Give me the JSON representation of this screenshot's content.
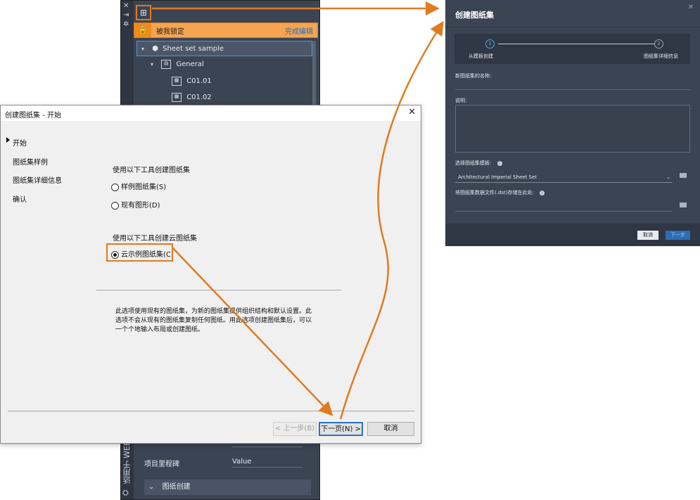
{
  "palette": {
    "rail_icons": [
      "close-icon",
      "pin-icon",
      "settings-icon"
    ],
    "rail_vertical_text": "适用于 WEB 的",
    "new_sheet_set_glyph": "⊞",
    "lock_bar": {
      "text": "被我锁定",
      "action": "完成编辑"
    },
    "tree": [
      {
        "label": "Sheet set sample",
        "level": 0,
        "type": "sheetset"
      },
      {
        "label": "General",
        "level": 1,
        "type": "subset"
      },
      {
        "label": "C01.01",
        "level": 2,
        "type": "sheet"
      },
      {
        "label": "C01.02",
        "level": 2,
        "type": "sheet"
      }
    ],
    "property": {
      "label": "项目里程碑",
      "value": "Value"
    },
    "section_header": "图纸创建"
  },
  "dialog": {
    "title": "创建图纸集 - 开始",
    "steps": [
      "开始",
      "图纸集样例",
      "图纸集详细信息",
      "确认"
    ],
    "active_step": 0,
    "group1_label": "使用以下工具创建图纸集",
    "option_example": "样例图纸集(S)",
    "option_existing": "现有图形(D)",
    "group2_label": "使用以下工具创建云图纸集",
    "option_cloud": "云示例图纸集(C)",
    "selected_option": "cloud",
    "description": "此选项使用现有的图纸集，为新的图纸集提供组织结构和默认设置。此选项不会从现有的图纸集复制任何图纸。用此选项创建图纸集后，可以一个个地输入布局或创建图纸。",
    "buttons": {
      "back": "< 上一步(B)",
      "next": "下一页(N) >",
      "cancel": "取消"
    }
  },
  "cloud_dialog": {
    "title": "创建图纸集",
    "steps": [
      {
        "number": "1",
        "label": "从模板创建"
      },
      {
        "number": "2",
        "label": "图纸集详细信息"
      }
    ],
    "name_label": "新图纸集的名称:",
    "description_label": "说明:",
    "template_label": "选择图纸集模板:",
    "template_value": "Architectural Imperial Sheet Set",
    "storage_label": "将图纸集数据文件(.dst)存储在此处:",
    "buttons": {
      "cancel": "取消",
      "next": "下一步"
    }
  },
  "colors": {
    "highlight_orange": "#e07b1f",
    "dark_panel": "#3b4453",
    "accent_blue": "#2d6db4"
  }
}
